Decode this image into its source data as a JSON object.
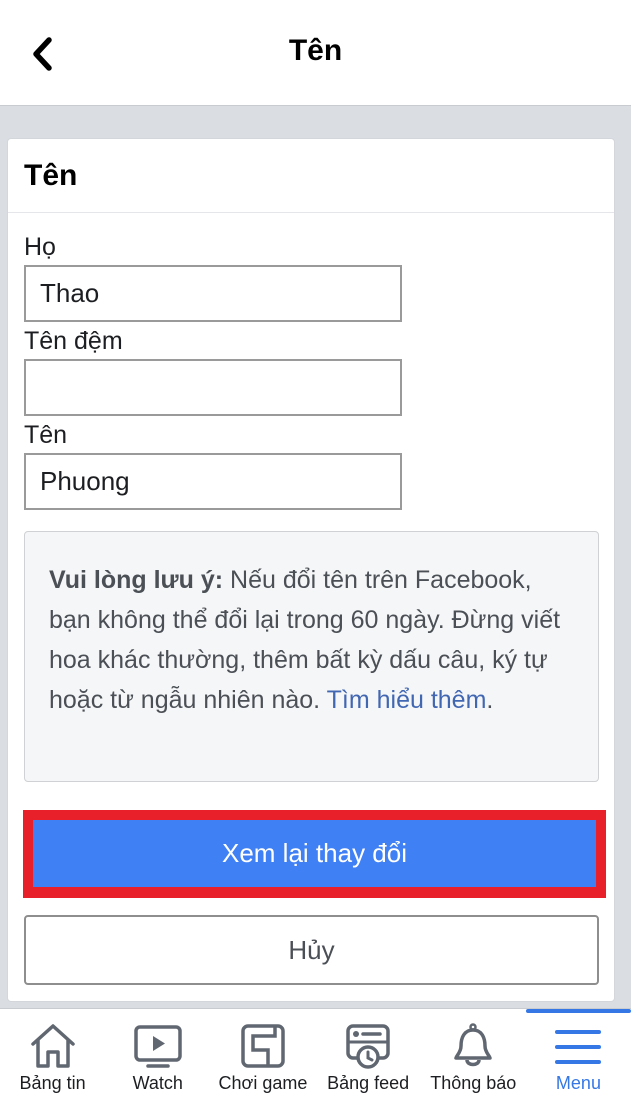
{
  "header": {
    "title": "Tên",
    "back_icon": "chevron-left-icon"
  },
  "card": {
    "title": "Tên",
    "fields": [
      {
        "label": "Họ",
        "value": "Thao",
        "placeholder": ""
      },
      {
        "label": "Tên đệm",
        "value": "",
        "placeholder": ""
      },
      {
        "label": "Tên",
        "value": "Phuong",
        "placeholder": ""
      }
    ],
    "note": {
      "bold": "Vui lòng lưu ý:",
      "text": " Nếu đổi tên trên Facebook, bạn không thể đổi lại trong 60 ngày. Đừng viết hoa khác thường, thêm bất kỳ dấu câu, ký tự hoặc từ ngẫu nhiên nào. ",
      "link": "Tìm hiểu thêm",
      "end": "."
    },
    "primary_button": "Xem lại thay đổi",
    "cancel_button": "Hủy"
  },
  "colors": {
    "primary": "#4080f5",
    "highlight": "#e8202a",
    "active_tab": "#3578e5",
    "link": "#4267b2"
  },
  "tabbar": {
    "items": [
      {
        "label": "Bảng tin",
        "icon": "home-icon",
        "active": false
      },
      {
        "label": "Watch",
        "icon": "watch-play-icon",
        "active": false
      },
      {
        "label": "Chơi game",
        "icon": "gaming-icon",
        "active": false
      },
      {
        "label": "Bảng feed",
        "icon": "feeds-icon",
        "active": false
      },
      {
        "label": "Thông báo",
        "icon": "bell-icon",
        "active": false
      },
      {
        "label": "Menu",
        "icon": "menu-icon",
        "active": true
      }
    ]
  }
}
